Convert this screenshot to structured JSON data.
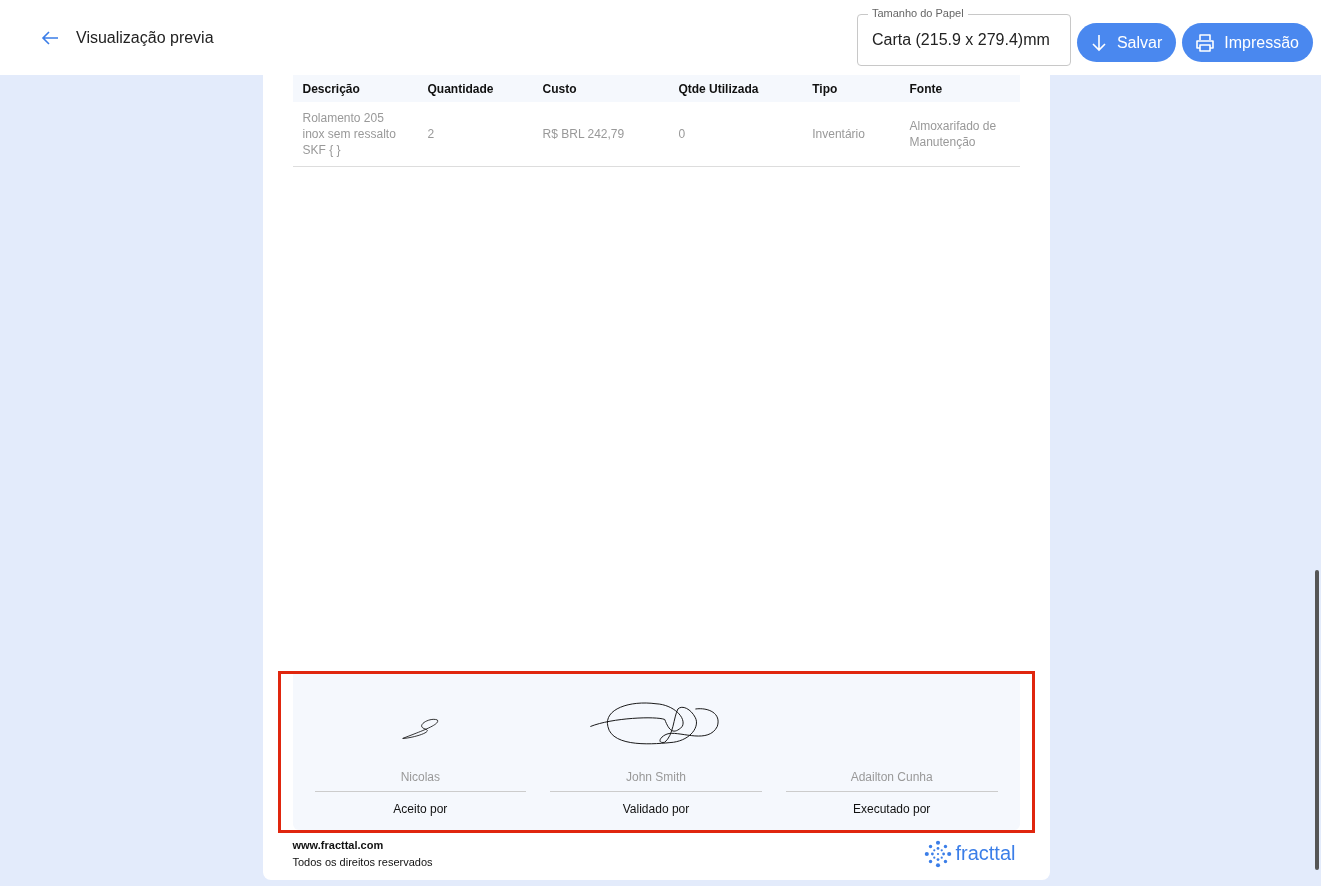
{
  "header": {
    "title": "Visualização previa",
    "paper_size": {
      "label": "Tamanho do Papel",
      "value": "Carta (215.9 x 279.4)mm"
    },
    "buttons": [
      {
        "label": "Salvar",
        "kind": "save"
      },
      {
        "label": "Impressão",
        "kind": "print"
      }
    ]
  },
  "table": {
    "columns": [
      "Descrição",
      "Quantidade",
      "Custo",
      "Qtde Utilizada",
      "Tipo",
      "Fonte"
    ],
    "rows": [
      [
        "Rolamento 205 inox sem ressalto SKF { }",
        "2",
        "R$ BRL 242,79",
        "0",
        "Inventário",
        "Almoxarifado de Manutenção"
      ]
    ]
  },
  "signatures": {
    "highlighted": true,
    "items": [
      {
        "name": "Nicolas",
        "role": "Aceito por",
        "signed": true
      },
      {
        "name": "John Smith",
        "role": "Validado por",
        "signed": true
      },
      {
        "name": "Adailton Cunha",
        "role": "Executado por",
        "signed": false
      }
    ]
  },
  "footer": {
    "website": "www.fracttal.com",
    "rights": "Todos os direitos reservados",
    "logo_text": "fracttal"
  }
}
